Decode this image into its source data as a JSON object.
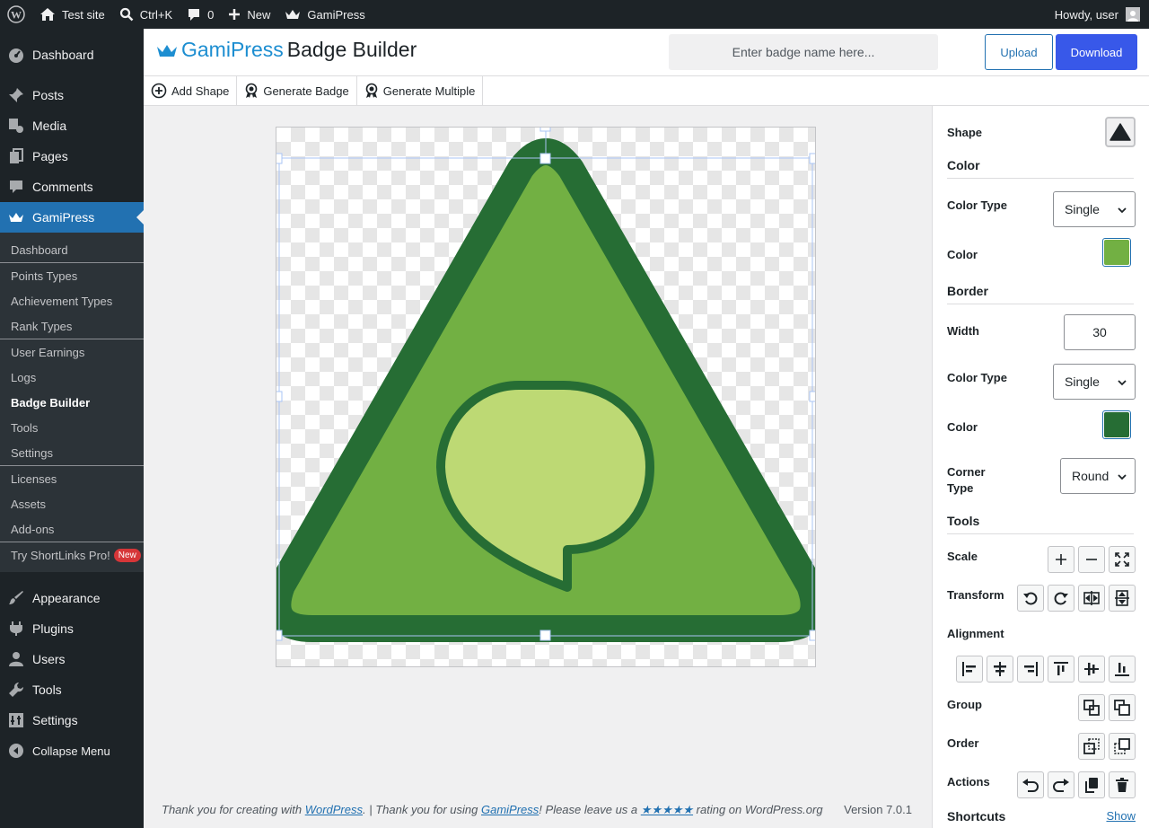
{
  "adminbar": {
    "site_name": "Test site",
    "search_shortcut": "Ctrl+K",
    "comments_count": "0",
    "new_label": "New",
    "gamipress_label": "GamiPress",
    "howdy": "Howdy, user"
  },
  "sidebar": {
    "items": [
      {
        "label": "Dashboard",
        "icon": "dashboard-icon"
      },
      {
        "label": "Posts",
        "icon": "pushpin-icon"
      },
      {
        "label": "Media",
        "icon": "media-icon"
      },
      {
        "label": "Pages",
        "icon": "pages-icon"
      },
      {
        "label": "Comments",
        "icon": "comment-icon"
      },
      {
        "label": "GamiPress",
        "icon": "crown-icon"
      }
    ],
    "submenu": [
      "Dashboard",
      "Points Types",
      "Achievement Types",
      "Rank Types",
      "User Earnings",
      "Logs",
      "Badge Builder",
      "Tools",
      "Settings",
      "Licenses",
      "Assets",
      "Add-ons",
      "Try ShortLinks Pro!"
    ],
    "new_badge": "New",
    "lower_items": [
      {
        "label": "Appearance",
        "icon": "paintbrush-icon"
      },
      {
        "label": "Plugins",
        "icon": "plugin-icon"
      },
      {
        "label": "Users",
        "icon": "users-icon"
      },
      {
        "label": "Tools",
        "icon": "wrench-icon"
      },
      {
        "label": "Settings",
        "icon": "settings-icon"
      },
      {
        "label": "Collapse Menu",
        "icon": "collapse-icon"
      }
    ]
  },
  "header": {
    "brand": "GamiPress",
    "title": "Badge Builder",
    "badge_name_placeholder": "Enter badge name here...",
    "upload_label": "Upload",
    "download_label": "Download"
  },
  "toolbar": {
    "add_shape": "Add Shape",
    "generate_badge": "Generate Badge",
    "generate_multiple": "Generate Multiple"
  },
  "canvas": {
    "fill_color": "#72b043",
    "border_color": "#266d34",
    "bubble_color": "#bdd974"
  },
  "footer": {
    "text_1": "Thank you for creating with ",
    "link_wp": "WordPress",
    "text_2": ". | Thank you for using ",
    "link_gp": "GamiPress",
    "text_3": "! Please leave us a ",
    "stars": "★★★★★",
    "text_4": " rating on WordPress.org",
    "version": "Version 7.0.1"
  },
  "panel": {
    "shape_label": "Shape",
    "color_section": "Color",
    "color_type_label": "Color Type",
    "color_type_value": "Single",
    "color_label": "Color",
    "color_value": "#72b043",
    "border_section": "Border",
    "width_label": "Width",
    "width_value": "30",
    "border_color_type_label": "Color Type",
    "border_color_type_value": "Single",
    "border_color_label": "Color",
    "border_color_value": "#266d34",
    "corner_type_label": "Corner Type",
    "corner_type_value": "Round",
    "tools_section": "Tools",
    "scale_label": "Scale",
    "transform_label": "Transform",
    "alignment_label": "Alignment",
    "group_label": "Group",
    "order_label": "Order",
    "actions_label": "Actions",
    "shortcuts_label": "Shortcuts",
    "shortcuts_show": "Show"
  }
}
